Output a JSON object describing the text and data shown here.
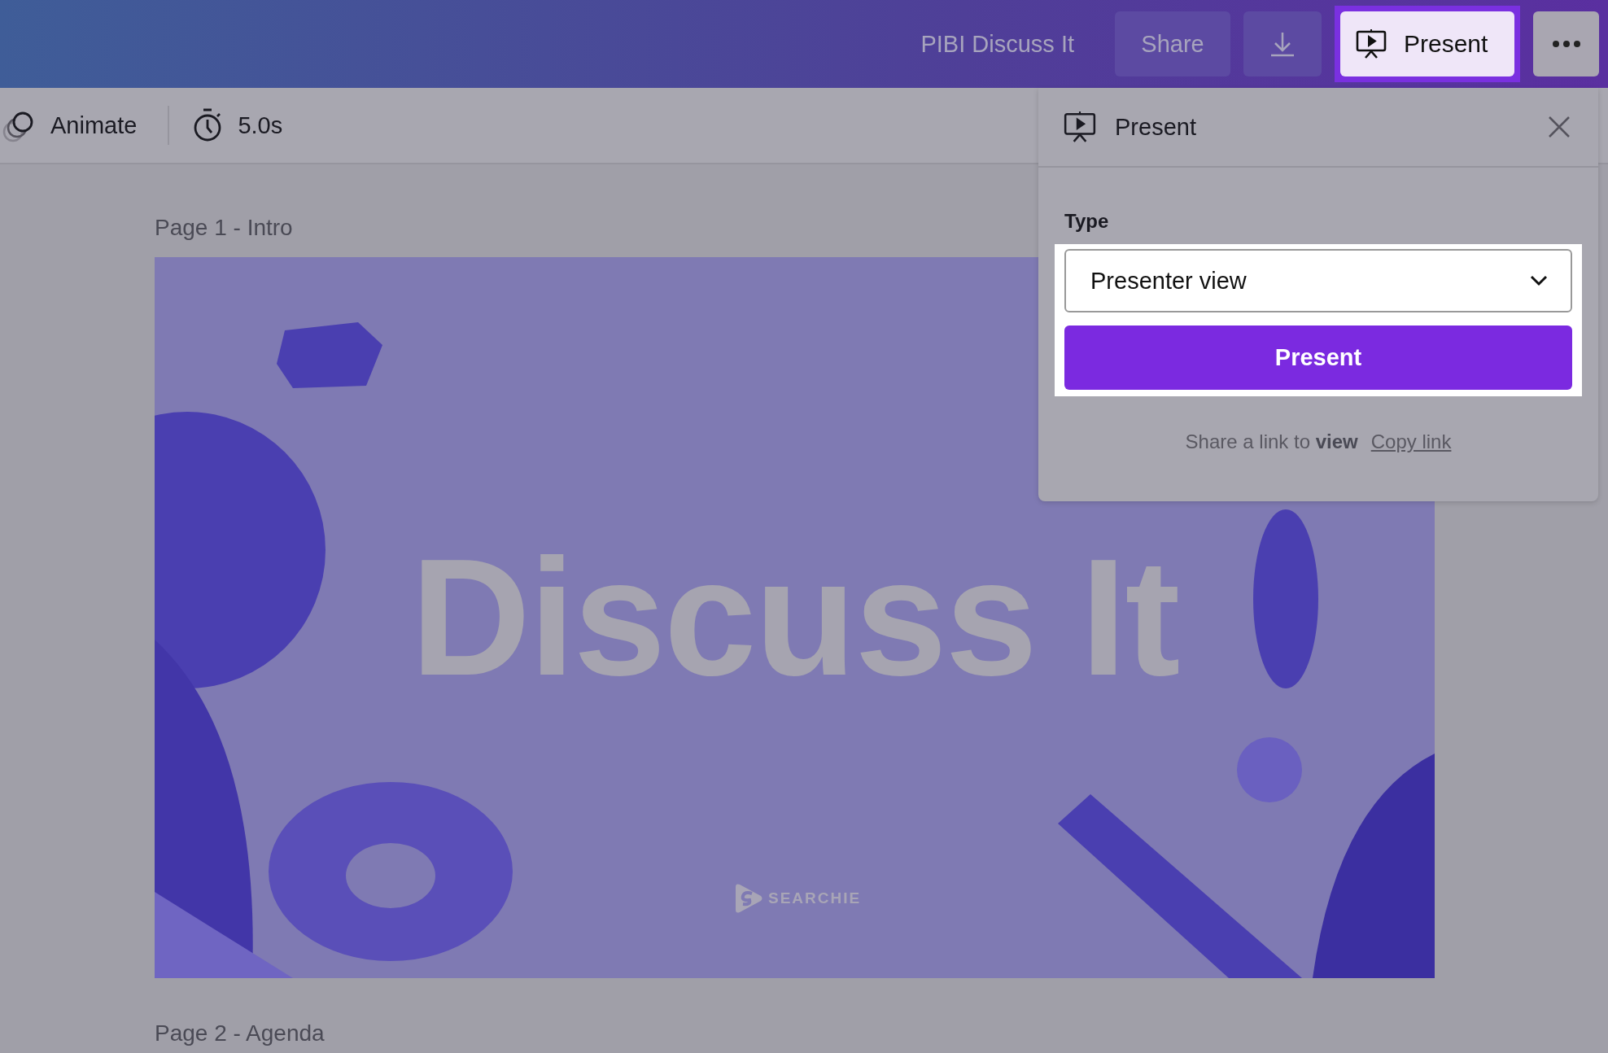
{
  "top_bar": {
    "title": "PIBI Discuss It",
    "share_button": "Share",
    "present_button": "Present"
  },
  "toolbar": {
    "animate": "Animate",
    "duration": "5.0s"
  },
  "pages": [
    {
      "label": "Page 1 - Intro",
      "slide": {
        "title": "Discuss It",
        "logo": "SEARCHIE"
      }
    },
    {
      "label": "Page 2 - Agenda"
    }
  ],
  "present_panel": {
    "title": "Present",
    "type_label": "Type",
    "type_value": "Presenter view",
    "button": "Present",
    "share_text": "Share a link to **view**",
    "copy_link": "Copy link"
  }
}
